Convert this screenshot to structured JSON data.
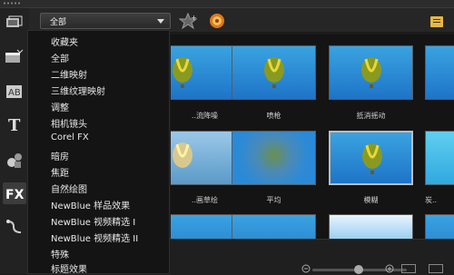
{
  "dropdown": {
    "selected": "全部"
  },
  "menu": {
    "items": [
      "收藏夹",
      "全部",
      "二维映射",
      "三维纹理映射",
      "调整",
      "相机镜头",
      "Corel FX",
      "暗房",
      "焦距",
      "自然绘图",
      "NewBlue 样品效果",
      "NewBlue 视频精选 I",
      "NewBlue 视频精选 II",
      "特殊",
      "标题效果"
    ]
  },
  "effects": {
    "row1": [
      "..流降噪",
      "喷枪",
      "抵消摇动"
    ],
    "row2": [
      "..画草绘",
      "平均",
      "模糊",
      "炭.."
    ]
  },
  "colors": {
    "accent": "#e8b840",
    "thumb_sky": "#2a8ad8",
    "balloon_green": "#9aa420",
    "balloon_yellow": "#e8d83c"
  },
  "icons": [
    "media-library-icon",
    "instant-project-icon",
    "transition-icon",
    "title-icon",
    "graphic-icon",
    "fx-icon",
    "path-icon",
    "favorite-add-icon",
    "color-wheel-icon",
    "options-icon"
  ]
}
